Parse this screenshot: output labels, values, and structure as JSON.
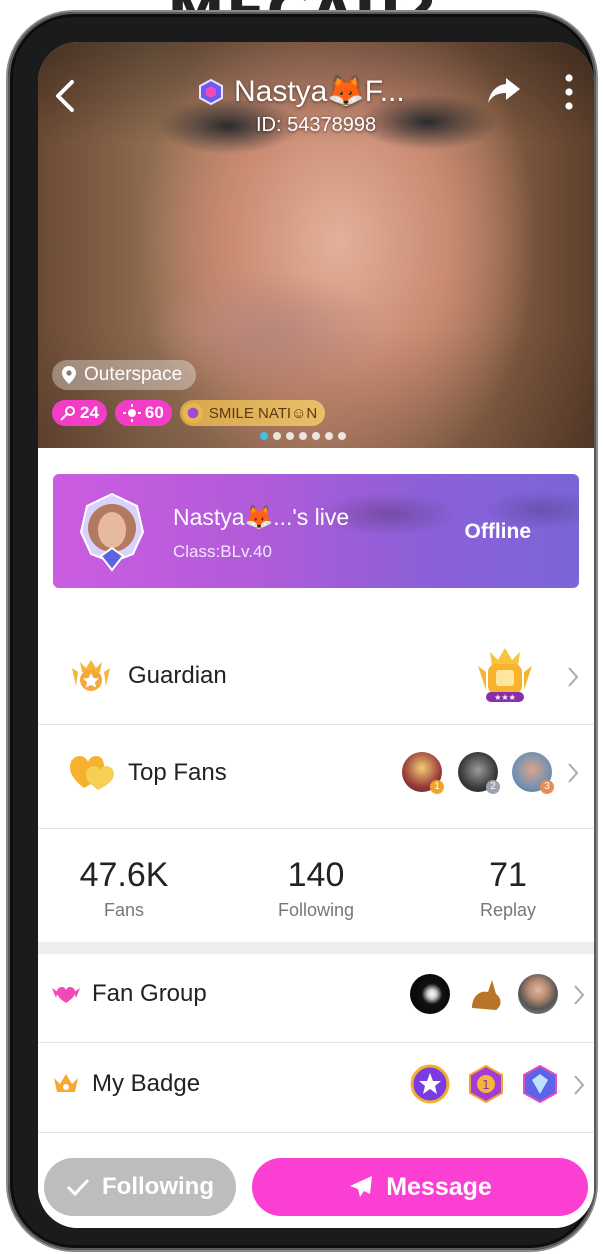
{
  "overlay_caption": "MECAU?",
  "header": {
    "name": "Nastya🦊F...",
    "user_id": "ID: 54378998"
  },
  "profile": {
    "location": "Outerspace",
    "tags": {
      "level_a": "24",
      "level_b": "60",
      "group": "SMILE NATI☺N"
    },
    "photo_count": 7,
    "photo_active_index": 0
  },
  "live": {
    "title": "Nastya🦊...'s live",
    "class": "Class:BLv.40",
    "status": "Offline"
  },
  "rows": {
    "guardian": "Guardian",
    "top_fans": "Top Fans",
    "top_fans_ranks": [
      "1",
      "2",
      "3"
    ],
    "fan_group": "Fan Group",
    "my_badge": "My Badge"
  },
  "stats": [
    {
      "value": "47.6K",
      "label": "Fans"
    },
    {
      "value": "140",
      "label": "Following"
    },
    {
      "value": "71",
      "label": "Replay"
    }
  ],
  "actions": {
    "following": "Following",
    "message": "Message"
  },
  "colors": {
    "accent_pink": "#fb3fd3",
    "tag_pink": "#f23ec7",
    "following_gray": "#bdbdbd",
    "live_purple": "#b05bd9"
  }
}
